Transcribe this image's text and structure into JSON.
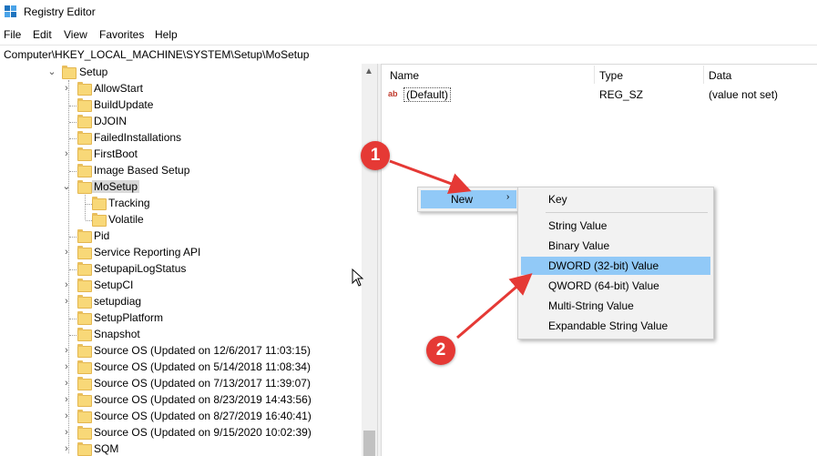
{
  "window": {
    "title": "Registry Editor"
  },
  "menu": {
    "file": "File",
    "edit": "Edit",
    "view": "View",
    "favorites": "Favorites",
    "help": "Help"
  },
  "address": "Computer\\HKEY_LOCAL_MACHINE\\SYSTEM\\Setup\\MoSetup",
  "tree": {
    "items": [
      {
        "label": "Setup"
      },
      {
        "label": "AllowStart"
      },
      {
        "label": "BuildUpdate"
      },
      {
        "label": "DJOIN"
      },
      {
        "label": "FailedInstallations"
      },
      {
        "label": "FirstBoot"
      },
      {
        "label": "Image Based Setup"
      },
      {
        "label": "MoSetup"
      },
      {
        "label": "Tracking"
      },
      {
        "label": "Volatile"
      },
      {
        "label": "Pid"
      },
      {
        "label": "Service Reporting API"
      },
      {
        "label": "SetupapiLogStatus"
      },
      {
        "label": "SetupCI"
      },
      {
        "label": "setupdiag"
      },
      {
        "label": "SetupPlatform"
      },
      {
        "label": "Snapshot"
      },
      {
        "label": "Source OS (Updated on 12/6/2017 11:03:15)"
      },
      {
        "label": "Source OS (Updated on 5/14/2018 11:08:34)"
      },
      {
        "label": "Source OS (Updated on 7/13/2017 11:39:07)"
      },
      {
        "label": "Source OS (Updated on 8/23/2019 14:43:56)"
      },
      {
        "label": "Source OS (Updated on 8/27/2019 16:40:41)"
      },
      {
        "label": "Source OS (Updated on 9/15/2020 10:02:39)"
      },
      {
        "label": "SQM"
      }
    ]
  },
  "list": {
    "columns": {
      "name": "Name",
      "type": "Type",
      "data": "Data"
    },
    "rows": [
      {
        "name": "(Default)",
        "type": "REG_SZ",
        "data": "(value not set)"
      }
    ]
  },
  "context_menu": {
    "new_label": "New"
  },
  "submenu": {
    "items": [
      {
        "label": "Key"
      },
      {
        "label": "String Value"
      },
      {
        "label": "Binary Value"
      },
      {
        "label": "DWORD (32-bit) Value"
      },
      {
        "label": "QWORD (64-bit) Value"
      },
      {
        "label": "Multi-String Value"
      },
      {
        "label": "Expandable String Value"
      }
    ],
    "highlighted": "DWORD (32-bit) Value"
  },
  "annotations": {
    "step1": "1",
    "step2": "2",
    "color": "#e53935"
  }
}
